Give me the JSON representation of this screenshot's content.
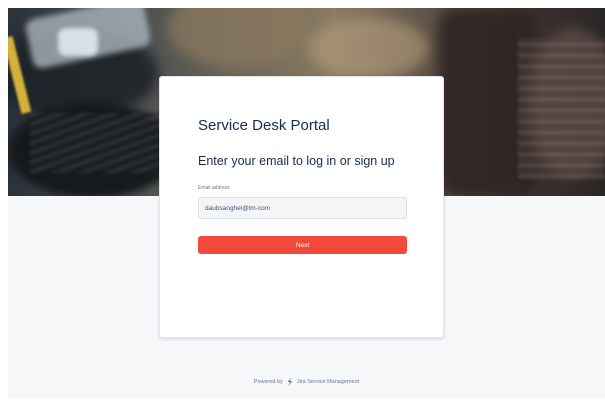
{
  "card": {
    "title": "Service Desk Portal",
    "heading": "Enter your email to log in or sign up",
    "email_label": "Email address",
    "email_value": "daubsanghel@lm-com",
    "next_label": "Next"
  },
  "footer": {
    "powered_by": "Powered by",
    "product": "Jira Service Management"
  },
  "colors": {
    "accent": "#f2493a",
    "text": "#172b4d",
    "background": "#f6f7f9"
  },
  "icons": {
    "footer_logo": "bolt-icon"
  }
}
